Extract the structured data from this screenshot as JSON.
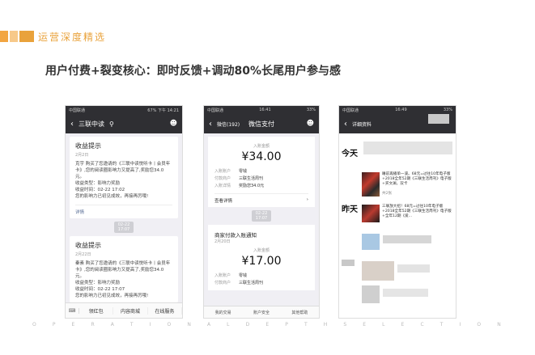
{
  "header": {
    "section_tag": "运营深度精选",
    "headline": "用户付费+裂变核心：即时反馈+调动80%长尾用户参与感"
  },
  "phone1": {
    "status_left": "中国联通",
    "status_right": "67%  下午 14:21",
    "nav_title": "三联中读",
    "card1": {
      "title": "收益提示",
      "date": "2月2日",
      "lines": [
        "克宇 购买了您邀请的《三联中读悦听卡丨会员年卡》,您的阅读圈影响力又提高了,奖励您34.0元。",
        "收益类型：影响力奖励",
        "收益时间：02-22 17:02",
        "您的影响力已初见成效，再接再厉哦!"
      ],
      "link": "详情"
    },
    "time_badge": "02-22 17:07",
    "card2": {
      "title": "收益提示",
      "date": "2月22日",
      "lines": [
        "秦素 购买了您邀请的《三联中读悦听卡丨会员年卡》,您的阅读圈影响力又提高了,奖励您34.0元。",
        "收益类型：影响力奖励",
        "收益时间：02-22 17:07",
        "您的影响力已初见成效，再接再厉哦!"
      ],
      "link": "详情"
    },
    "menu": [
      "领红包",
      "内容商城",
      "在线服务"
    ]
  },
  "phone2": {
    "status_left": "中国联通",
    "status_time": "16:41",
    "status_right": "33%",
    "nav_back": "微信(192)",
    "nav_title": "微信支付",
    "pay1": {
      "label": "入账金额",
      "amount": "¥34.00",
      "rows": [
        {
          "k": "入账账户",
          "v": "零钱"
        },
        {
          "k": "付款商户",
          "v": "三联生活周刊"
        },
        {
          "k": "入账详情",
          "v": "奖励您34.0元"
        }
      ],
      "more": "查看详情"
    },
    "time_badge": "02-22 17:07",
    "pay2": {
      "title": "商家付款入账通知",
      "date": "2月20日",
      "label": "入账金额",
      "amount": "¥17.00",
      "rows": [
        {
          "k": "入账账户",
          "v": "零钱"
        },
        {
          "k": "付款商户",
          "v": "三联生活周刊"
        }
      ]
    },
    "bottom_menu": [
      "我的交易",
      "账户安全",
      "其他帮助"
    ]
  },
  "phone3": {
    "status_left": "中国联通",
    "status_time": "16:49",
    "status_right": "33%",
    "nav_back": "详细资料",
    "today": "今天",
    "yesterday": "昨天",
    "post1": "睡前再播单一波。68元=过往10年电子版+2018全年52期《三联生活周刊》电子版+买文澜，双卡",
    "post1_count": "共2张",
    "post2": "三联放大招！68元=过往10年电子版+2018全年52期《三联生活周刊》电子版+全年12期《爱..."
  },
  "footer": {
    "letters": [
      "O",
      "P",
      "E",
      "R",
      "A",
      "T",
      "I",
      "O",
      "N",
      "A",
      "L",
      "D",
      "E",
      "P",
      "T",
      "H",
      "S",
      "E",
      "L",
      "E",
      "C",
      "T",
      "I",
      "O",
      "N"
    ]
  }
}
